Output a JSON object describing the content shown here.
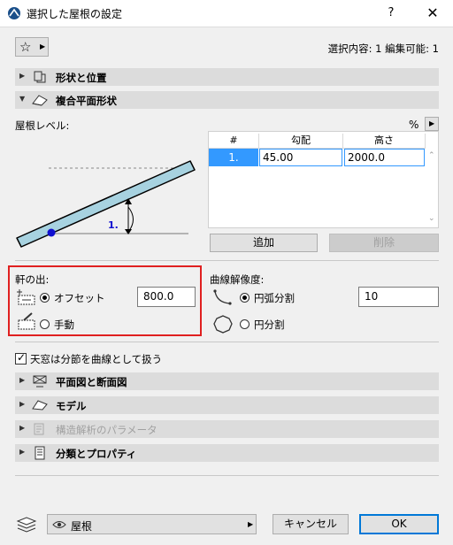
{
  "window": {
    "title": "選択した屋根の設定",
    "help": "?",
    "close": "✕"
  },
  "header": {
    "selection_info": "選択内容: 1 編集可能: 1"
  },
  "sections": {
    "shape": "形状と位置",
    "complex": "複合平面形状",
    "plan": "平面図と断面図",
    "model": "モデル",
    "structural": "構造解析のパラメータ",
    "classification": "分類とプロパティ"
  },
  "roof_level": {
    "label": "屋根レベル:",
    "unit": "%",
    "diagram_label": "1.",
    "table": {
      "headers": [
        "#",
        "勾配",
        "高さ"
      ],
      "rows": [
        {
          "num": "1.",
          "pitch": "45.00",
          "height": "2000.0"
        }
      ]
    },
    "add_button": "追加",
    "delete_button": "削除"
  },
  "eaves": {
    "label": "軒の出:",
    "offset_label": "オフセット",
    "offset_value": "800.0",
    "manual_label": "手動",
    "selected": "offset"
  },
  "curve": {
    "label": "曲線解像度:",
    "arc_label": "円弧分割",
    "arc_value": "10",
    "circle_label": "円分割",
    "selected": "arc"
  },
  "skylight_checkbox": {
    "label": "天窓は分節を曲線として扱う",
    "checked": true
  },
  "footer": {
    "layer": "屋根",
    "cancel": "キャンセル",
    "ok": "OK"
  },
  "colors": {
    "selected_row": "#3399ff",
    "highlight_border": "#e02020",
    "roof_fill": "#a7d2e0",
    "point": "#1010d0"
  }
}
